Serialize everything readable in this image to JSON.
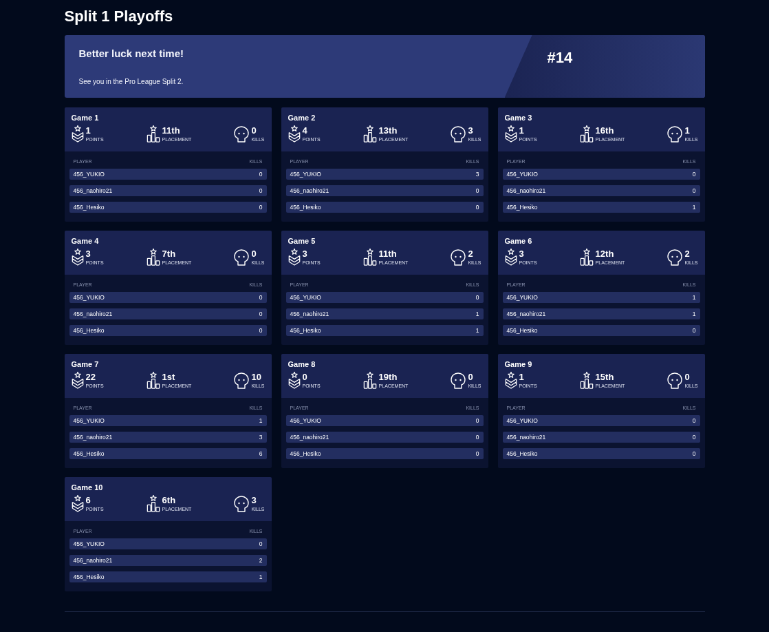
{
  "page": {
    "title": "Split 1 Playoffs"
  },
  "banner": {
    "heading": "Better luck next time!",
    "message": "See you in the Pro League Split 2.",
    "rank": "#14"
  },
  "games": [
    {
      "title": "Game 1",
      "stats": [
        {
          "kind": "points",
          "value": "1",
          "label": "POINTS"
        },
        {
          "kind": "placement",
          "value": "11th",
          "label": "PLACEMENT"
        },
        {
          "kind": "kills",
          "value": "0",
          "label": "KILLS"
        }
      ],
      "columns": [
        "PLAYER",
        "KILLS"
      ],
      "players": [
        {
          "name": "456_YUKIO",
          "kills": "0"
        },
        {
          "name": "456_naohiro21",
          "kills": "0"
        },
        {
          "name": "456_Hesiko",
          "kills": "0"
        }
      ]
    },
    {
      "title": "Game 2",
      "stats": [
        {
          "kind": "points",
          "value": "4",
          "label": "POINTS"
        },
        {
          "kind": "placement",
          "value": "13th",
          "label": "PLACEMENT"
        },
        {
          "kind": "kills",
          "value": "3",
          "label": "KILLS"
        }
      ],
      "columns": [
        "PLAYER",
        "KILLS"
      ],
      "players": [
        {
          "name": "456_YUKIO",
          "kills": "3"
        },
        {
          "name": "456_naohiro21",
          "kills": "0"
        },
        {
          "name": "456_Hesiko",
          "kills": "0"
        }
      ]
    },
    {
      "title": "Game 3",
      "stats": [
        {
          "kind": "points",
          "value": "1",
          "label": "POINTS"
        },
        {
          "kind": "placement",
          "value": "16th",
          "label": "PLACEMENT"
        },
        {
          "kind": "kills",
          "value": "1",
          "label": "KILLS"
        }
      ],
      "columns": [
        "PLAYER",
        "KILLS"
      ],
      "players": [
        {
          "name": "456_YUKIO",
          "kills": "0"
        },
        {
          "name": "456_naohiro21",
          "kills": "0"
        },
        {
          "name": "456_Hesiko",
          "kills": "1"
        }
      ]
    },
    {
      "title": "Game 4",
      "stats": [
        {
          "kind": "points",
          "value": "3",
          "label": "POINTS"
        },
        {
          "kind": "placement",
          "value": "7th",
          "label": "PLACEMENT"
        },
        {
          "kind": "kills",
          "value": "0",
          "label": "KILLS"
        }
      ],
      "columns": [
        "PLAYER",
        "KILLS"
      ],
      "players": [
        {
          "name": "456_YUKIO",
          "kills": "0"
        },
        {
          "name": "456_naohiro21",
          "kills": "0"
        },
        {
          "name": "456_Hesiko",
          "kills": "0"
        }
      ]
    },
    {
      "title": "Game 5",
      "stats": [
        {
          "kind": "points",
          "value": "3",
          "label": "POINTS"
        },
        {
          "kind": "placement",
          "value": "11th",
          "label": "PLACEMENT"
        },
        {
          "kind": "kills",
          "value": "2",
          "label": "KILLS"
        }
      ],
      "columns": [
        "PLAYER",
        "KILLS"
      ],
      "players": [
        {
          "name": "456_YUKIO",
          "kills": "0"
        },
        {
          "name": "456_naohiro21",
          "kills": "1"
        },
        {
          "name": "456_Hesiko",
          "kills": "1"
        }
      ]
    },
    {
      "title": "Game 6",
      "stats": [
        {
          "kind": "points",
          "value": "3",
          "label": "POINTS"
        },
        {
          "kind": "placement",
          "value": "12th",
          "label": "PLACEMENT"
        },
        {
          "kind": "kills",
          "value": "2",
          "label": "KILLS"
        }
      ],
      "columns": [
        "PLAYER",
        "KILLS"
      ],
      "players": [
        {
          "name": "456_YUKIO",
          "kills": "1"
        },
        {
          "name": "456_naohiro21",
          "kills": "1"
        },
        {
          "name": "456_Hesiko",
          "kills": "0"
        }
      ]
    },
    {
      "title": "Game 7",
      "stats": [
        {
          "kind": "points",
          "value": "22",
          "label": "POINTS"
        },
        {
          "kind": "placement",
          "value": "1st",
          "label": "PLACEMENT"
        },
        {
          "kind": "kills",
          "value": "10",
          "label": "KILLS"
        }
      ],
      "columns": [
        "PLAYER",
        "KILLS"
      ],
      "players": [
        {
          "name": "456_YUKIO",
          "kills": "1"
        },
        {
          "name": "456_naohiro21",
          "kills": "3"
        },
        {
          "name": "456_Hesiko",
          "kills": "6"
        }
      ]
    },
    {
      "title": "Game 8",
      "stats": [
        {
          "kind": "points",
          "value": "0",
          "label": "POINTS"
        },
        {
          "kind": "placement",
          "value": "19th",
          "label": "PLACEMENT"
        },
        {
          "kind": "kills",
          "value": "0",
          "label": "KILLS"
        }
      ],
      "columns": [
        "PLAYER",
        "KILLS"
      ],
      "players": [
        {
          "name": "456_YUKIO",
          "kills": "0"
        },
        {
          "name": "456_naohiro21",
          "kills": "0"
        },
        {
          "name": "456_Hesiko",
          "kills": "0"
        }
      ]
    },
    {
      "title": "Game 9",
      "stats": [
        {
          "kind": "points",
          "value": "1",
          "label": "POINTS"
        },
        {
          "kind": "placement",
          "value": "15th",
          "label": "PLACEMENT"
        },
        {
          "kind": "kills",
          "value": "0",
          "label": "KILLS"
        }
      ],
      "columns": [
        "PLAYER",
        "KILLS"
      ],
      "players": [
        {
          "name": "456_YUKIO",
          "kills": "0"
        },
        {
          "name": "456_naohiro21",
          "kills": "0"
        },
        {
          "name": "456_Hesiko",
          "kills": "0"
        }
      ]
    },
    {
      "title": "Game 10",
      "stats": [
        {
          "kind": "points",
          "value": "6",
          "label": "POINTS"
        },
        {
          "kind": "placement",
          "value": "6th",
          "label": "PLACEMENT"
        },
        {
          "kind": "kills",
          "value": "3",
          "label": "KILLS"
        }
      ],
      "columns": [
        "PLAYER",
        "KILLS"
      ],
      "players": [
        {
          "name": "456_YUKIO",
          "kills": "0"
        },
        {
          "name": "456_naohiro21",
          "kills": "2"
        },
        {
          "name": "456_Hesiko",
          "kills": "1"
        }
      ]
    }
  ]
}
